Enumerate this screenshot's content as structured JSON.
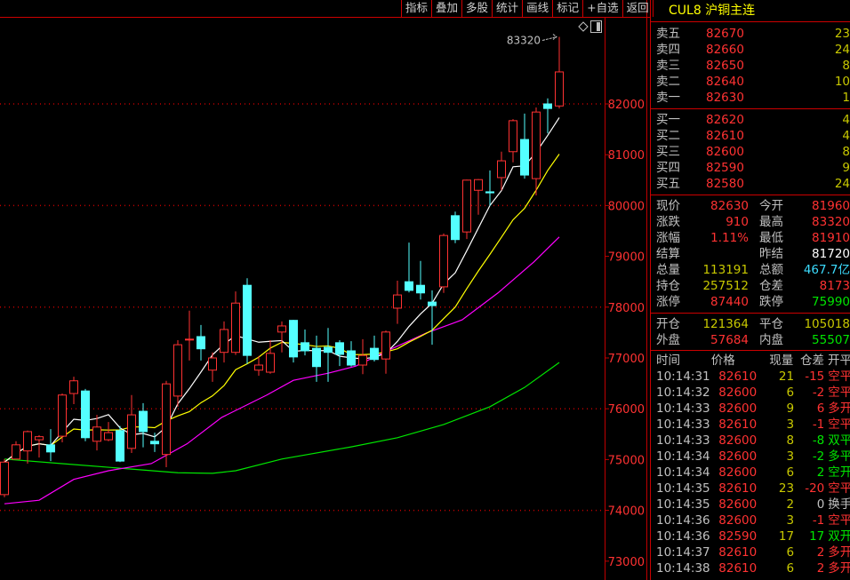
{
  "toolbar": {
    "buttons": [
      "指标",
      "叠加",
      "多股",
      "统计",
      "画线",
      "标记",
      "+自选",
      "返回"
    ]
  },
  "colors": {
    "up": "#ff3232",
    "down": "#54ffff",
    "ma5": "#ffffff",
    "ma10": "#ffff00",
    "ma20": "#ff00ff",
    "ma60": "#00e600",
    "grid": "#c00000"
  },
  "chart_data": {
    "type": "candlestick",
    "ylim": [
      72850,
      83650
    ],
    "yticks": [
      73000,
      74000,
      75000,
      76000,
      77000,
      78000,
      79000,
      80000,
      81000,
      82000
    ],
    "yticks_label": [
      "73000",
      "74000",
      "75000",
      "76000",
      "77000",
      "78000",
      "79000",
      "80000",
      "81000",
      "82000"
    ],
    "grid_dotted": [
      74000,
      76000,
      78000,
      80000,
      82000
    ],
    "high_annotation": {
      "label": "83320",
      "value": 83320
    },
    "ohlc": [
      [
        74310,
        75010,
        74260,
        74950
      ],
      [
        75010,
        75360,
        75010,
        75290
      ],
      [
        75170,
        75570,
        74920,
        75550
      ],
      [
        75390,
        75480,
        75040,
        75450
      ],
      [
        75290,
        75600,
        74970,
        75150
      ],
      [
        75460,
        76300,
        75340,
        76270
      ],
      [
        76300,
        76630,
        76090,
        76550
      ],
      [
        76350,
        76390,
        75360,
        75430
      ],
      [
        75360,
        75880,
        75180,
        75640
      ],
      [
        75390,
        75740,
        75360,
        75530
      ],
      [
        75570,
        75660,
        74950,
        74970
      ],
      [
        75220,
        76270,
        75130,
        75880
      ],
      [
        75950,
        76110,
        75240,
        75550
      ],
      [
        75360,
        75530,
        75150,
        75310
      ],
      [
        75100,
        76550,
        74850,
        76490
      ],
      [
        76250,
        77350,
        76040,
        77260
      ],
      [
        77360,
        77930,
        76950,
        77370
      ],
      [
        77420,
        77650,
        76950,
        77180
      ],
      [
        76760,
        77110,
        76530,
        77000
      ],
      [
        77110,
        77720,
        76910,
        77560
      ],
      [
        77110,
        78310,
        77060,
        78080
      ],
      [
        78430,
        78570,
        76880,
        77050
      ],
      [
        76760,
        77040,
        76650,
        76860
      ],
      [
        76720,
        77350,
        76690,
        77090
      ],
      [
        77510,
        77720,
        77110,
        77630
      ],
      [
        77740,
        77750,
        76910,
        77020
      ],
      [
        77300,
        77560,
        77050,
        77140
      ],
      [
        77190,
        77440,
        76530,
        76830
      ],
      [
        77210,
        77590,
        76530,
        77110
      ],
      [
        77300,
        77350,
        76840,
        77070
      ],
      [
        77140,
        77330,
        76830,
        76860
      ],
      [
        76860,
        77370,
        76680,
        77050
      ],
      [
        77190,
        77440,
        76930,
        76970
      ],
      [
        76980,
        77540,
        76690,
        77510
      ],
      [
        77980,
        78520,
        77670,
        78240
      ],
      [
        78500,
        79270,
        78290,
        78330
      ],
      [
        78430,
        78910,
        78150,
        78280
      ],
      [
        78100,
        78330,
        77260,
        78030
      ],
      [
        78400,
        79450,
        78280,
        79410
      ],
      [
        79800,
        79880,
        79260,
        79330
      ],
      [
        79480,
        80510,
        79340,
        80500
      ],
      [
        80300,
        80520,
        79820,
        80510
      ],
      [
        80270,
        80690,
        79990,
        80250
      ],
      [
        80550,
        81060,
        80300,
        80880
      ],
      [
        81060,
        81700,
        80850,
        81670
      ],
      [
        81300,
        81810,
        80530,
        80600
      ],
      [
        80530,
        81930,
        80200,
        81840
      ],
      [
        82000,
        82110,
        81420,
        81910
      ],
      [
        81960,
        83320,
        81910,
        82630
      ]
    ],
    "ma20_points": [
      [
        0,
        74130
      ],
      [
        3,
        74200
      ],
      [
        6,
        74610
      ],
      [
        9,
        74780
      ],
      [
        12.7,
        74920
      ],
      [
        15.8,
        75310
      ],
      [
        18.8,
        75830
      ],
      [
        22.7,
        76270
      ],
      [
        25,
        76560
      ],
      [
        28,
        76700
      ],
      [
        30.4,
        76840
      ],
      [
        33.5,
        77180
      ],
      [
        36.5,
        77490
      ],
      [
        39.6,
        77750
      ],
      [
        42.7,
        78280
      ],
      [
        45.8,
        78890
      ],
      [
        48,
        79380
      ]
    ],
    "ma60_points": [
      [
        0,
        75010
      ],
      [
        5,
        74920
      ],
      [
        10,
        74830
      ],
      [
        15,
        74740
      ],
      [
        18,
        74730
      ],
      [
        20,
        74780
      ],
      [
        24,
        75010
      ],
      [
        30,
        75250
      ],
      [
        34,
        75430
      ],
      [
        38,
        75690
      ],
      [
        42,
        76040
      ],
      [
        45,
        76420
      ],
      [
        48,
        76910
      ]
    ]
  },
  "quote": {
    "title": "CUL8 沪铜主连",
    "asks": [
      {
        "label": "卖五",
        "price": "82670",
        "vol": "23"
      },
      {
        "label": "卖四",
        "price": "82660",
        "vol": "24"
      },
      {
        "label": "卖三",
        "price": "82650",
        "vol": "8"
      },
      {
        "label": "卖二",
        "price": "82640",
        "vol": "10"
      },
      {
        "label": "卖一",
        "price": "82630",
        "vol": "1"
      }
    ],
    "bids": [
      {
        "label": "买一",
        "price": "82620",
        "vol": "4"
      },
      {
        "label": "买二",
        "price": "82610",
        "vol": "4"
      },
      {
        "label": "买三",
        "price": "82600",
        "vol": "8"
      },
      {
        "label": "买四",
        "price": "82590",
        "vol": "9"
      },
      {
        "label": "买五",
        "price": "82580",
        "vol": "24"
      }
    ],
    "stats": [
      {
        "l1": "现价",
        "v1": "82630",
        "c1": "red",
        "l2": "今开",
        "v2": "81960",
        "c2": "red"
      },
      {
        "l1": "涨跌",
        "v1": "910",
        "c1": "red",
        "l2": "最高",
        "v2": "83320",
        "c2": "red"
      },
      {
        "l1": "涨幅",
        "v1": "1.11%",
        "c1": "red",
        "l2": "最低",
        "v2": "81910",
        "c2": "red"
      },
      {
        "l1": "结算",
        "v1": "",
        "c1": "red",
        "l2": "昨结",
        "v2": "81720",
        "c2": "wht"
      },
      {
        "l1": "总量",
        "v1": "113191",
        "c1": "yel",
        "l2": "总额",
        "v2": "467.7亿",
        "c2": "cyn"
      },
      {
        "l1": "持仓",
        "v1": "257512",
        "c1": "yel",
        "l2": "仓差",
        "v2": "8173",
        "c2": "red"
      },
      {
        "l1": "涨停",
        "v1": "87440",
        "c1": "red",
        "l2": "跌停",
        "v2": "75990",
        "c2": "grn"
      }
    ],
    "flow": [
      {
        "l1": "开仓",
        "v1": "121364",
        "c1": "yel",
        "l2": "平仓",
        "v2": "105018",
        "c2": "yel"
      },
      {
        "l1": "外盘",
        "v1": "57684",
        "c1": "red",
        "l2": "内盘",
        "v2": "55507",
        "c2": "grn"
      }
    ]
  },
  "trades": {
    "headers": [
      "时间",
      "价格",
      "现量",
      "仓差",
      "开平"
    ],
    "rows": [
      {
        "time": "10:14:31",
        "price": "82610",
        "vol": "21",
        "oi": "-15",
        "oic": "red",
        "type": "空平",
        "tc": "red"
      },
      {
        "time": "10:14:32",
        "price": "82600",
        "vol": "6",
        "oi": "-2",
        "oic": "red",
        "type": "空平",
        "tc": "red"
      },
      {
        "time": "10:14:33",
        "price": "82600",
        "vol": "9",
        "oi": "6",
        "oic": "red",
        "type": "多开",
        "tc": "red"
      },
      {
        "time": "10:14:33",
        "price": "82610",
        "vol": "3",
        "oi": "-1",
        "oic": "red",
        "type": "空平",
        "tc": "red"
      },
      {
        "time": "10:14:33",
        "price": "82600",
        "vol": "8",
        "oi": "-8",
        "oic": "grn",
        "type": "双平",
        "tc": "grn"
      },
      {
        "time": "10:14:34",
        "price": "82600",
        "vol": "3",
        "oi": "-2",
        "oic": "grn",
        "type": "多平",
        "tc": "grn"
      },
      {
        "time": "10:14:34",
        "price": "82600",
        "vol": "6",
        "oi": "2",
        "oic": "grn",
        "type": "空开",
        "tc": "grn"
      },
      {
        "time": "10:14:35",
        "price": "82610",
        "vol": "23",
        "oi": "-20",
        "oic": "red",
        "type": "空平",
        "tc": "red"
      },
      {
        "time": "10:14:35",
        "price": "82600",
        "vol": "2",
        "oi": "0",
        "oic": "gry",
        "type": "换手",
        "tc": "gry"
      },
      {
        "time": "10:14:36",
        "price": "82600",
        "vol": "3",
        "oi": "-1",
        "oic": "red",
        "type": "空平",
        "tc": "red"
      },
      {
        "time": "10:14:36",
        "price": "82590",
        "vol": "17",
        "oi": "17",
        "oic": "grn",
        "type": "双开",
        "tc": "grn"
      },
      {
        "time": "10:14:37",
        "price": "82610",
        "vol": "6",
        "oi": "2",
        "oic": "red",
        "type": "多开",
        "tc": "red"
      },
      {
        "time": "10:14:38",
        "price": "82610",
        "vol": "6",
        "oi": "2",
        "oic": "red",
        "type": "多开",
        "tc": "red"
      }
    ]
  }
}
